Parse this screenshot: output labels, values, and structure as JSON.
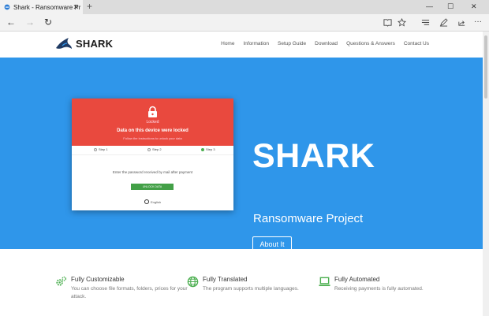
{
  "browser": {
    "tab_title": "Shark - Ransomware Pr",
    "tab_close": "✕",
    "new_tab": "+",
    "win_min": "—",
    "win_max": "☐",
    "win_close": "✕",
    "nav_back": "←",
    "nav_forward": "→",
    "nav_refresh": "↻"
  },
  "header": {
    "logo_text": "SHARK",
    "menu": [
      "Home",
      "Information",
      "Setup Guide",
      "Download",
      "Questions & Answers",
      "Contact Us"
    ]
  },
  "card": {
    "locked_label": "Locked",
    "title": "Data on this device were locked",
    "subtitle": "Follow the instructions to unlock your data",
    "steps": [
      "Step 1",
      "Step 2",
      "Step 3"
    ],
    "message": "Enter the password received by mail after payment",
    "button": "UNLOCK DATA",
    "footer": "English"
  },
  "hero": {
    "title": "SHARK",
    "subtitle": "Ransomware Project",
    "button": "About It"
  },
  "features": [
    {
      "title": "Fully Customizable",
      "desc": "You can choose file formats, folders, prices for your attack.",
      "icon": "gears-icon",
      "color": "#4caf50"
    },
    {
      "title": "Fully Translated",
      "desc": "The program supports multiple languages.",
      "icon": "globe-icon",
      "color": "#4caf50"
    },
    {
      "title": "Fully Automated",
      "desc": "Receiving payments is fully automated.",
      "icon": "laptop-icon",
      "color": "#4caf50"
    }
  ],
  "colors": {
    "hero": "#2f96ea",
    "card_top": "#e9493e",
    "accent": "#43a047"
  }
}
